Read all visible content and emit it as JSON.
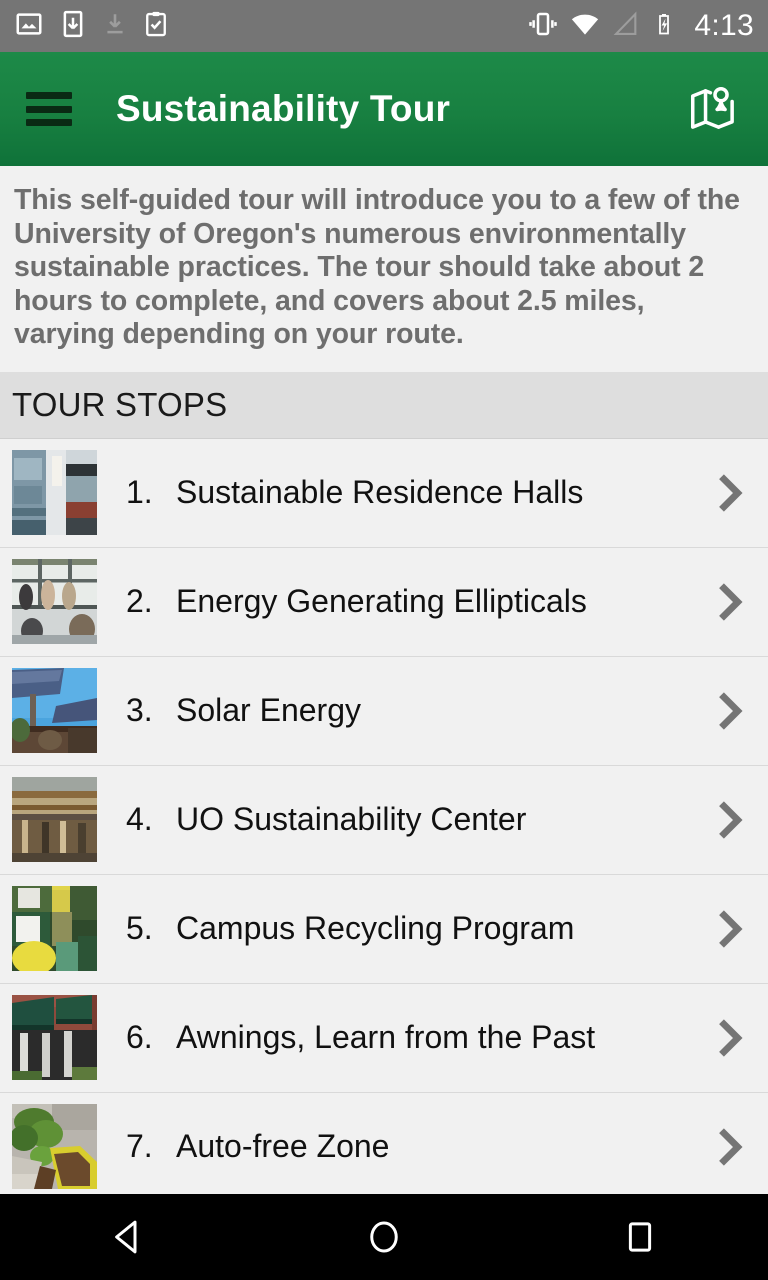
{
  "status_bar": {
    "time": "4:13",
    "left_icons": [
      {
        "name": "image-notification-icon"
      },
      {
        "name": "download-to-device-icon"
      },
      {
        "name": "download-icon"
      },
      {
        "name": "clipboard-check-icon"
      }
    ],
    "right_icons": [
      {
        "name": "vibrate-icon"
      },
      {
        "name": "wifi-icon"
      },
      {
        "name": "cellular-signal-icon"
      },
      {
        "name": "battery-charging-icon"
      }
    ]
  },
  "app_bar": {
    "menu_label": "Menu",
    "title": "Sustainability Tour",
    "map_label": "Map"
  },
  "description": "This self-guided tour will introduce you to a few of the University of Oregon's numerous environmentally sustainable practices. The tour should take about 2 hours to complete, and covers about 2.5 miles, varying depending on your route.",
  "section": {
    "header": "TOUR STOPS"
  },
  "stops": [
    {
      "num": "1.",
      "title": "Sustainable Residence Halls",
      "thumb": "residence-hall-photo"
    },
    {
      "num": "2.",
      "title": "Energy Generating Ellipticals",
      "thumb": "gym-interior-photo"
    },
    {
      "num": "3.",
      "title": "Solar Energy",
      "thumb": "solar-panel-photo"
    },
    {
      "num": "4.",
      "title": "UO Sustainability Center",
      "thumb": "atrium-interior-photo"
    },
    {
      "num": "5.",
      "title": "Campus Recycling Program",
      "thumb": "recycling-bins-photo"
    },
    {
      "num": "6.",
      "title": "Awnings, Learn from the Past",
      "thumb": "green-awnings-photo"
    },
    {
      "num": "7.",
      "title": "Auto-free Zone",
      "thumb": "planter-greenery-photo"
    }
  ],
  "nav_bar": {
    "back_label": "Back",
    "home_label": "Home",
    "recents_label": "Recents"
  },
  "colors": {
    "app_bar_green": "#188041",
    "status_bar_grey": "#757575",
    "background": "#f1f1f1",
    "section_band": "#dedede",
    "description_text": "#6e6e6e",
    "chevron_grey": "#757575"
  }
}
